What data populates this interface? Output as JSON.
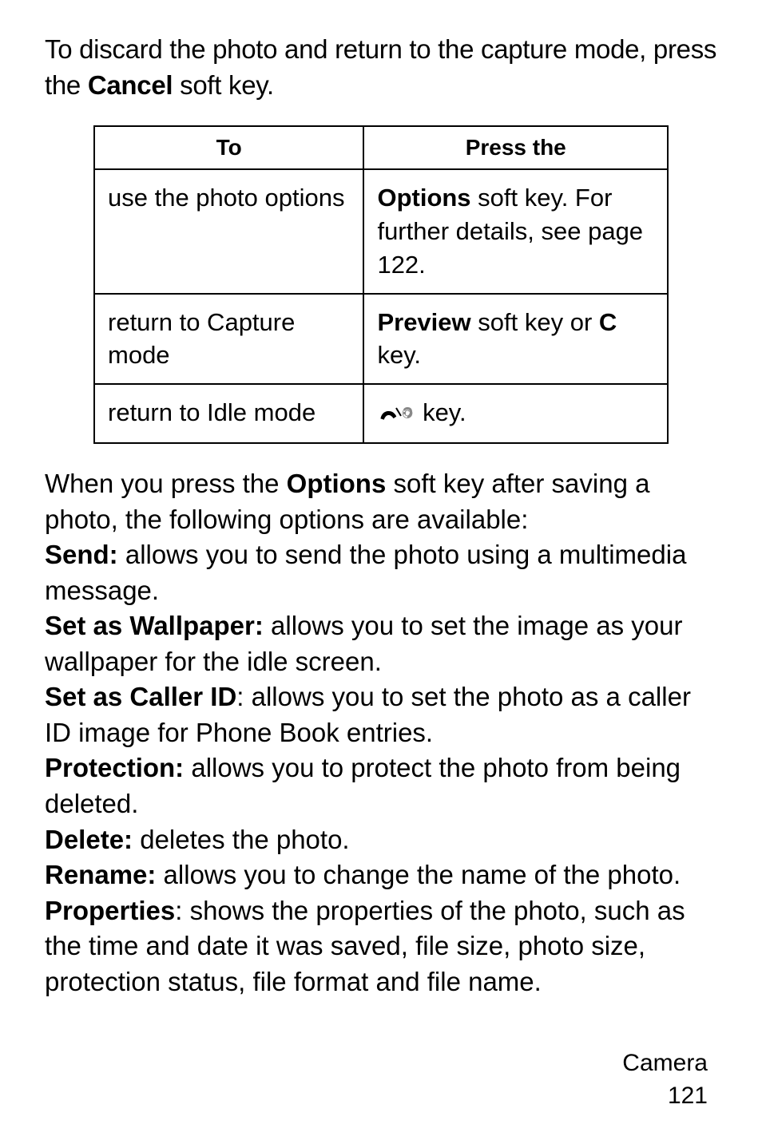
{
  "intro": {
    "line1": "To discard the photo and return to the capture mode, press the ",
    "cancel": "Cancel",
    "line1_end": " soft key."
  },
  "table": {
    "header_to": "To",
    "header_press": "Press the",
    "rows": [
      {
        "to": "use the photo options",
        "press_prefix_bold": "Options",
        "press_rest": " soft key. For further details, see page 122."
      },
      {
        "to": "return to Capture mode",
        "press_prefix_bold": "Preview",
        "press_mid": " soft key or ",
        "press_bold2": "C",
        "press_end": " key."
      },
      {
        "to": "return to Idle mode",
        "press_icon": "end-call-icon",
        "press_end": " key."
      }
    ]
  },
  "body": {
    "p1a": "When you press the ",
    "p1b": "Options",
    "p1c": " soft key after saving a photo, the following options are available:",
    "send_label": "Send:",
    "send_text": " allows you to send the photo using a multimedia message.",
    "wallpaper_label": "Set as Wallpaper:",
    "wallpaper_text": " allows you to set the image as your wallpaper for the idle screen.",
    "callerid_label": "Set as Caller ID",
    "callerid_text": ": allows you to set the photo as a caller ID image for Phone Book entries.",
    "protection_label": "Protection:",
    "protection_text": " allows you to protect the photo from being deleted.",
    "delete_label": "Delete:",
    "delete_text": " deletes the photo.",
    "rename_label": "Rename:",
    "rename_text": " allows you to change the name of the photo.",
    "properties_label": "Properties",
    "properties_text": ": shows the properties of the photo, such as the time and date it was saved, file size, photo size, protection status, file format and file name."
  },
  "footer": {
    "section": "Camera",
    "page": "121"
  }
}
